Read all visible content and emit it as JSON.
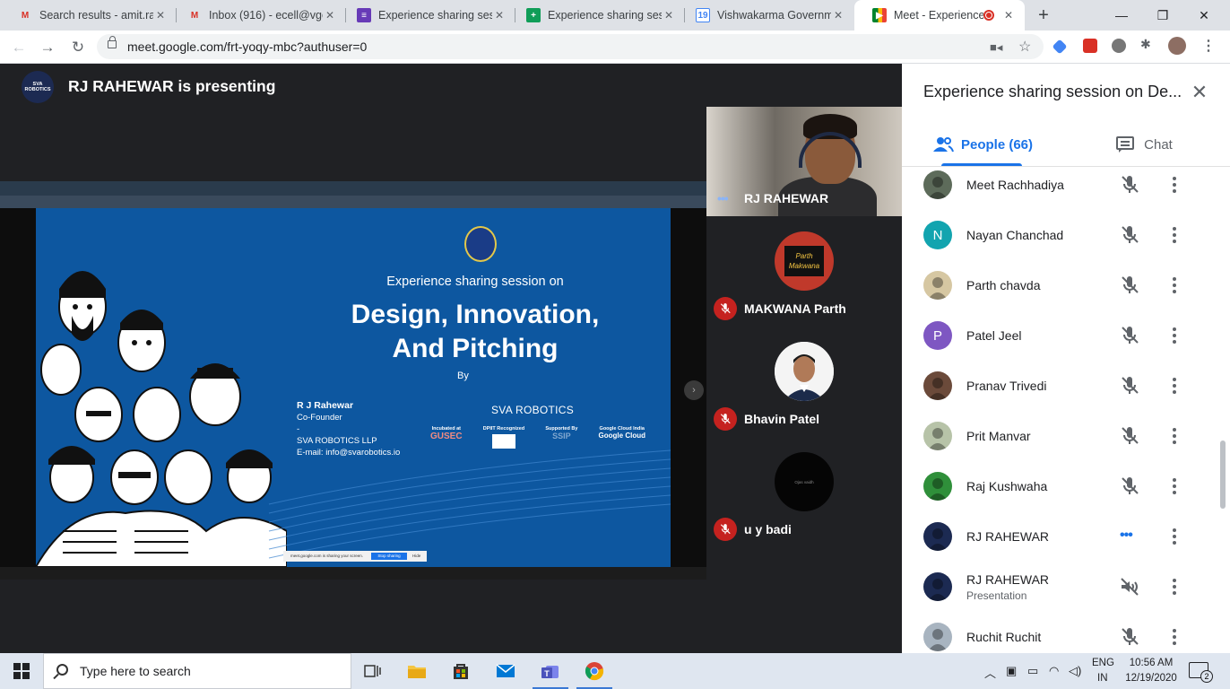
{
  "browser": {
    "tabs": [
      {
        "title": "Search results - amit.rat",
        "favicon": "gmail-icon",
        "active": false
      },
      {
        "title": "Inbox (916) - ecell@vge",
        "favicon": "gmail-icon",
        "active": false
      },
      {
        "title": "Experience sharing sess",
        "favicon": "google-forms-icon",
        "active": false
      },
      {
        "title": "Experience sharing sess",
        "favicon": "google-sheets-icon",
        "active": false
      },
      {
        "title": "Vishwakarma Governme",
        "favicon": "google-calendar-icon",
        "active": false
      },
      {
        "title": "Meet - Experience",
        "favicon": "google-meet-icon",
        "active": true
      }
    ],
    "url": "meet.google.com/frt-yoqy-mbc?authuser=0"
  },
  "meet": {
    "presenter_banner": "RJ RAHEWAR is presenting",
    "presenter_logo_text": "SVA ROBOTICS",
    "slide": {
      "subtitle": "Experience sharing session on",
      "title_line1": "Design, Innovation,",
      "title_line2": "And Pitching",
      "by": "By",
      "speaker_name": "R J Rahewar",
      "speaker_role": "Co-Founder",
      "speaker_dash": "-",
      "speaker_company": "SVA ROBOTICS LLP",
      "speaker_email": "E-mail: info@svarobotics.io",
      "brand": "SVA ROBOTICS",
      "incubated_label": "Incubated at",
      "incubated_value": "GUSEC",
      "dpiit_label": "DPIIT Recognized",
      "supported_label": "Supported By",
      "supported_value": "SSIP",
      "cloud_label": "Google Cloud India",
      "cloud_value": "Google Cloud",
      "share_notice": "meet.google.com is sharing your screen.",
      "share_stop": "Stop sharing",
      "share_hide": "Hide"
    },
    "tiles": [
      {
        "name": "RJ RAHEWAR",
        "state": "speaking"
      },
      {
        "name": "MAKWANA Parth",
        "state": "muted",
        "avatar_text": "Parth Makwana"
      },
      {
        "name": "Bhavin Patel",
        "state": "muted"
      },
      {
        "name": "u y badi",
        "state": "muted",
        "avatar_text": "Ojas vaidh"
      }
    ]
  },
  "panel": {
    "title": "Experience sharing session on De...",
    "tab_people": "People (66)",
    "tab_chat": "Chat",
    "participants": [
      {
        "name": "Meet Rachhadiya",
        "sub": "",
        "avatar": "photo",
        "color": "#5d6b5a",
        "mic": "muted"
      },
      {
        "name": "Nayan Chanchad",
        "sub": "",
        "avatar": "N",
        "color": "#12a4af",
        "mic": "muted"
      },
      {
        "name": "Parth chavda",
        "sub": "",
        "avatar": "photo",
        "color": "#d6c7a2",
        "mic": "muted"
      },
      {
        "name": "Patel Jeel",
        "sub": "",
        "avatar": "P",
        "color": "#7e57c2",
        "mic": "muted"
      },
      {
        "name": "Pranav Trivedi",
        "sub": "",
        "avatar": "photo",
        "color": "#6b4a3a",
        "mic": "muted"
      },
      {
        "name": "Prit Manvar",
        "sub": "",
        "avatar": "photo",
        "color": "#b7c3a8",
        "mic": "muted"
      },
      {
        "name": "Raj Kushwaha",
        "sub": "",
        "avatar": "photo",
        "color": "#2f8f3a",
        "mic": "muted"
      },
      {
        "name": "RJ RAHEWAR",
        "sub": "",
        "avatar": "photo",
        "color": "#1c2a52",
        "mic": "speaking"
      },
      {
        "name": "RJ RAHEWAR",
        "sub": "Presentation",
        "avatar": "photo",
        "color": "#1c2a52",
        "mic": "presenting"
      },
      {
        "name": "Ruchit Ruchit",
        "sub": "",
        "avatar": "photo",
        "color": "#a8b4c0",
        "mic": "muted"
      }
    ]
  },
  "taskbar": {
    "search_placeholder": "Type here to search",
    "lang_line1": "ENG",
    "lang_line2": "IN",
    "time": "10:56 AM",
    "date": "12/19/2020",
    "notifications": "2"
  }
}
